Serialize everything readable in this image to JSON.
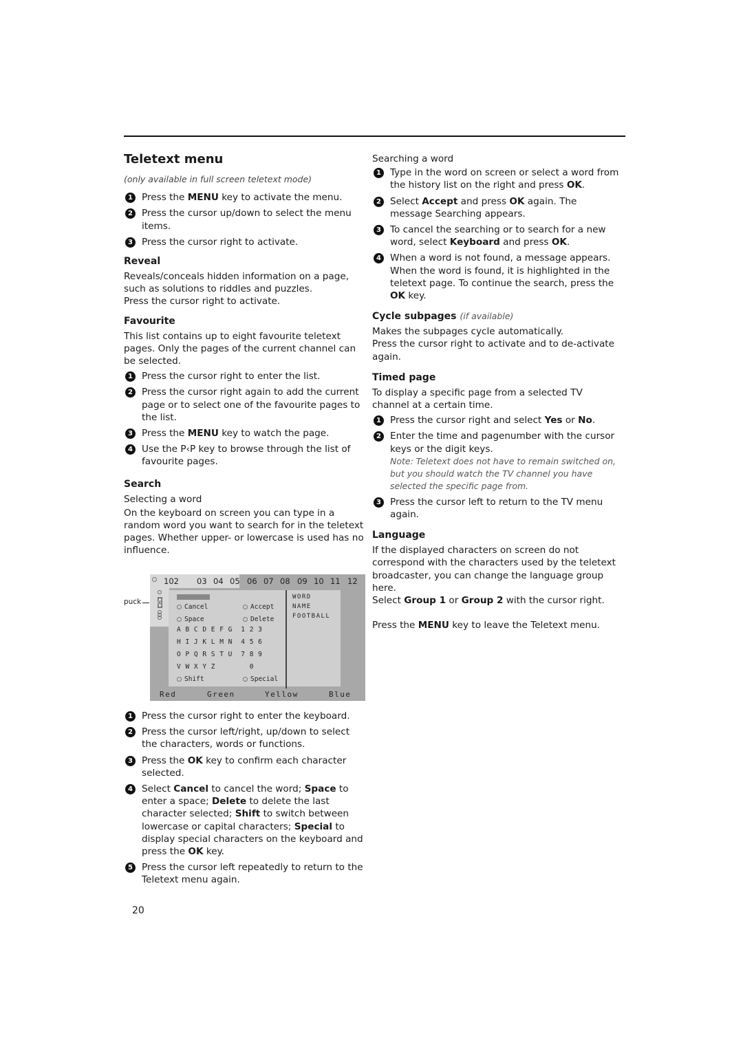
{
  "title": "Teletext menu",
  "subtitle": "(only available in full screen teletext mode)",
  "intro_steps": [
    {
      "n": "1",
      "parts": [
        [
          "Press the ",
          ""
        ],
        [
          "MENU",
          "b"
        ],
        [
          " key to activate the menu.",
          ""
        ]
      ]
    },
    {
      "n": "2",
      "parts": [
        [
          "Press the cursor up/down to select the menu items.",
          ""
        ]
      ]
    },
    {
      "n": "3",
      "parts": [
        [
          "Press the cursor right to activate.",
          ""
        ]
      ]
    }
  ],
  "reveal": {
    "heading": "Reveal",
    "text": "Reveals/conceals hidden information on a page, such as solutions to riddles and puzzles.",
    "text2": "Press the cursor right to activate."
  },
  "favourite": {
    "heading": "Favourite",
    "text": "This list contains up to eight favourite teletext pages. Only the pages of the current channel can be selected.",
    "steps": [
      {
        "n": "1",
        "parts": [
          [
            "Press the cursor right to enter the list.",
            ""
          ]
        ]
      },
      {
        "n": "2",
        "parts": [
          [
            "Press the cursor right again to add the current page or to select one of the favourite pages to the list.",
            ""
          ]
        ]
      },
      {
        "n": "3",
        "parts": [
          [
            "Press the ",
            ""
          ],
          [
            "MENU",
            "b"
          ],
          [
            " key to watch the page.",
            ""
          ]
        ]
      },
      {
        "n": "4",
        "parts": [
          [
            "Use the P‹P key to browse through the list of favourite pages.",
            ""
          ]
        ]
      }
    ]
  },
  "search": {
    "heading": "Search",
    "selecting_label": "Selecting a word",
    "text": "On the keyboard on screen you can type in a random word you want to search for in the teletext pages. Whether upper- or lowercase is used has no influence.",
    "steps": [
      {
        "n": "1",
        "parts": [
          [
            "Press the cursor right to enter the keyboard.",
            ""
          ]
        ]
      },
      {
        "n": "2",
        "parts": [
          [
            "Press the cursor left/right, up/down to select the characters, words or functions.",
            ""
          ]
        ]
      },
      {
        "n": "3",
        "parts": [
          [
            "Press the ",
            ""
          ],
          [
            "OK",
            "b"
          ],
          [
            " key to confirm each character selected.",
            ""
          ]
        ]
      },
      {
        "n": "4",
        "parts": [
          [
            "Select ",
            ""
          ],
          [
            "Cancel",
            "b"
          ],
          [
            " to cancel the word; ",
            ""
          ],
          [
            "Space",
            "b"
          ],
          [
            " to enter a space;  ",
            ""
          ],
          [
            "Delete",
            "b"
          ],
          [
            " to delete the last character selected; ",
            ""
          ],
          [
            "Shift",
            "b"
          ],
          [
            " to switch between lowercase or capital characters; ",
            ""
          ],
          [
            "Special",
            "b"
          ],
          [
            " to display special characters on the keyboard and press the ",
            ""
          ],
          [
            "OK",
            "b"
          ],
          [
            " key.",
            ""
          ]
        ]
      },
      {
        "n": "5",
        "parts": [
          [
            "Press the cursor left repeatedly to return to the Teletext menu again.",
            ""
          ]
        ]
      }
    ]
  },
  "teletext_screen": {
    "puck_label": "puck",
    "page_numbers": [
      "102",
      "03",
      "04",
      "05",
      "06",
      "07",
      "08",
      "09",
      "10",
      "11",
      "12"
    ],
    "functions": {
      "cancel": "Cancel",
      "accept": "Accept",
      "space": "Space",
      "delete": "Delete",
      "shift": "Shift",
      "special": "Special"
    },
    "rows": [
      "A B C D E F G  1 2 3",
      "H I J K L M N  4 5 6",
      "O P Q R S T U  7 8 9",
      "V W X Y Z        0"
    ],
    "history": [
      "WORD",
      "NAME",
      "FOOTBALL"
    ],
    "color_keys": [
      "Red",
      "Green",
      "Yellow",
      "Blue"
    ]
  },
  "searching": {
    "label": "Searching a word",
    "steps": [
      {
        "n": "1",
        "parts": [
          [
            "Type in the word on screen or select a word from the history list on the right and press ",
            ""
          ],
          [
            "OK",
            "b"
          ],
          [
            ".",
            ""
          ]
        ]
      },
      {
        "n": "2",
        "parts": [
          [
            "Select ",
            ""
          ],
          [
            "Accept",
            "b"
          ],
          [
            " and press ",
            ""
          ],
          [
            "OK",
            "b"
          ],
          [
            " again. The message Searching appears.",
            ""
          ]
        ]
      },
      {
        "n": "3",
        "parts": [
          [
            "To cancel the searching or to search for a new word, select ",
            ""
          ],
          [
            "Keyboard",
            "b"
          ],
          [
            " and press ",
            ""
          ],
          [
            "OK",
            "b"
          ],
          [
            ".",
            ""
          ]
        ]
      },
      {
        "n": "4",
        "parts": [
          [
            "When a word is not found, a message appears. When the word is found, it is highlighted in the teletext page. To continue the search, press the ",
            ""
          ],
          [
            "OK",
            "b"
          ],
          [
            " key.",
            ""
          ]
        ]
      }
    ]
  },
  "cycle": {
    "heading": "Cycle subpages",
    "heading_note": "(if available)",
    "text": "Makes the subpages cycle automatically.",
    "text2": "Press the cursor right to activate and to de-activate again."
  },
  "timed": {
    "heading": "Timed page",
    "text": "To display a specific page from a selected TV channel at a certain time.",
    "steps": [
      {
        "n": "1",
        "parts": [
          [
            "Press the cursor right and select ",
            ""
          ],
          [
            "Yes",
            "b"
          ],
          [
            " or ",
            ""
          ],
          [
            "No",
            "b"
          ],
          [
            ".",
            ""
          ]
        ]
      },
      {
        "n": "2",
        "parts": [
          [
            "Enter the time and pagenumber with the cursor keys or the digit keys.",
            ""
          ]
        ]
      }
    ],
    "note": "Note: Teletext does not have to remain switched on, but you should watch the TV channel you have selected the specific page from.",
    "steps2": [
      {
        "n": "3",
        "parts": [
          [
            "Press the cursor left to return to the TV menu again.",
            ""
          ]
        ]
      }
    ]
  },
  "language": {
    "heading": "Language",
    "text": "If the displayed characters on screen do not correspond with the characters used by the teletext broadcaster, you can change the language group here.",
    "select_parts": [
      [
        "Select ",
        ""
      ],
      [
        "Group 1",
        "b"
      ],
      [
        " or ",
        ""
      ],
      [
        "Group 2",
        "b"
      ],
      [
        " with the cursor right.",
        ""
      ]
    ],
    "leave_parts": [
      [
        "Press the ",
        ""
      ],
      [
        "MENU",
        "b"
      ],
      [
        " key to leave the Teletext menu.",
        ""
      ]
    ]
  },
  "page_number": "20"
}
